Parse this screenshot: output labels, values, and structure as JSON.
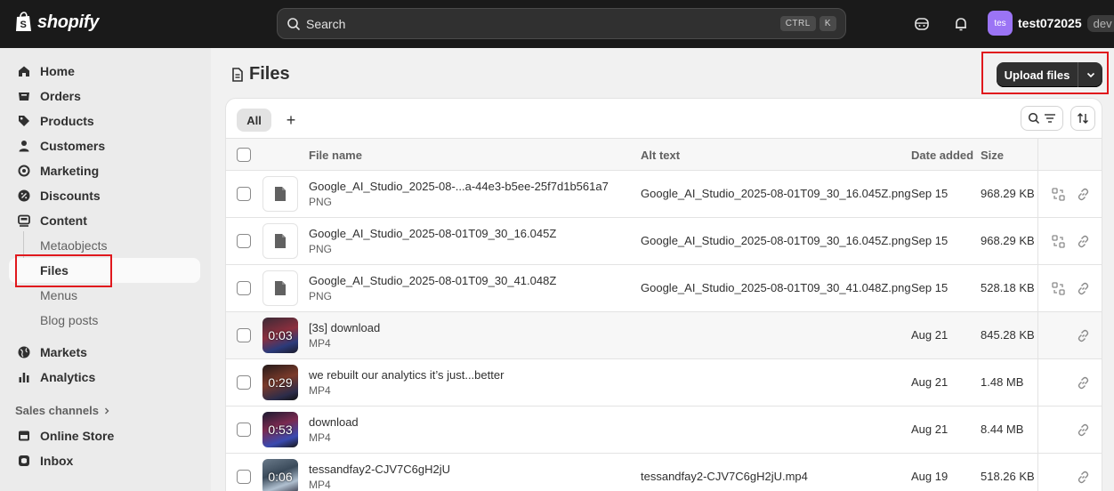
{
  "topbar": {
    "brand": "shopify",
    "search_placeholder": "Search",
    "shortcut_keys": [
      "CTRL",
      "K"
    ],
    "avatar_initials": "tes",
    "store_name": "test072025",
    "env_badge": "dev"
  },
  "sidebar": {
    "items": [
      {
        "label": "Home",
        "icon": "home-icon"
      },
      {
        "label": "Orders",
        "icon": "orders-icon"
      },
      {
        "label": "Products",
        "icon": "tag-icon"
      },
      {
        "label": "Customers",
        "icon": "person-icon"
      },
      {
        "label": "Marketing",
        "icon": "target-icon"
      },
      {
        "label": "Discounts",
        "icon": "discount-icon"
      },
      {
        "label": "Content",
        "icon": "content-icon"
      }
    ],
    "content_subitems": [
      "Metaobjects",
      "Files",
      "Menus",
      "Blog posts"
    ],
    "active_subitem": "Files",
    "items2": [
      {
        "label": "Markets",
        "icon": "globe-icon"
      },
      {
        "label": "Analytics",
        "icon": "bar-chart-icon"
      }
    ],
    "sales_channels_label": "Sales channels",
    "channels": [
      {
        "label": "Online Store",
        "icon": "store-icon"
      },
      {
        "label": "Inbox",
        "icon": "inbox-icon"
      }
    ]
  },
  "page": {
    "title": "Files",
    "upload_label": "Upload files"
  },
  "tabs": {
    "all_label": "All",
    "add_label": "+"
  },
  "table": {
    "headers": {
      "name": "File name",
      "alt": "Alt text",
      "date": "Date added",
      "size": "Size"
    },
    "rows": [
      {
        "name": "Google_AI_Studio_2025-08-...a-44e3-b5ee-25f7d1b561a7",
        "type": "PNG",
        "alt": "Google_AI_Studio_2025-08-01T09_30_16.045Z.png",
        "date": "Sep 15",
        "size": "968.29 KB",
        "thumb": "file",
        "duration": ""
      },
      {
        "name": "Google_AI_Studio_2025-08-01T09_30_16.045Z",
        "type": "PNG",
        "alt": "Google_AI_Studio_2025-08-01T09_30_16.045Z.png",
        "date": "Sep 15",
        "size": "968.29 KB",
        "thumb": "file",
        "duration": ""
      },
      {
        "name": "Google_AI_Studio_2025-08-01T09_30_41.048Z",
        "type": "PNG",
        "alt": "Google_AI_Studio_2025-08-01T09_30_41.048Z.png",
        "date": "Sep 15",
        "size": "528.18 KB",
        "thumb": "file",
        "duration": ""
      },
      {
        "name": "[3s] download",
        "type": "MP4",
        "alt": "",
        "date": "Aug 21",
        "size": "845.28 KB",
        "thumb": "video",
        "duration": "0:03"
      },
      {
        "name": "we rebuilt our analytics it’s just...better",
        "type": "MP4",
        "alt": "",
        "date": "Aug 21",
        "size": "1.48 MB",
        "thumb": "video",
        "duration": "0:29"
      },
      {
        "name": "download",
        "type": "MP4",
        "alt": "",
        "date": "Aug 21",
        "size": "8.44 MB",
        "thumb": "video",
        "duration": "0:53"
      },
      {
        "name": "tessandfay2-CJV7C6gH2jU",
        "type": "MP4",
        "alt": "tessandfay2-CJV7C6gH2jU.mp4",
        "date": "Aug 19",
        "size": "518.26 KB",
        "thumb": "video",
        "duration": "0:06"
      }
    ]
  }
}
